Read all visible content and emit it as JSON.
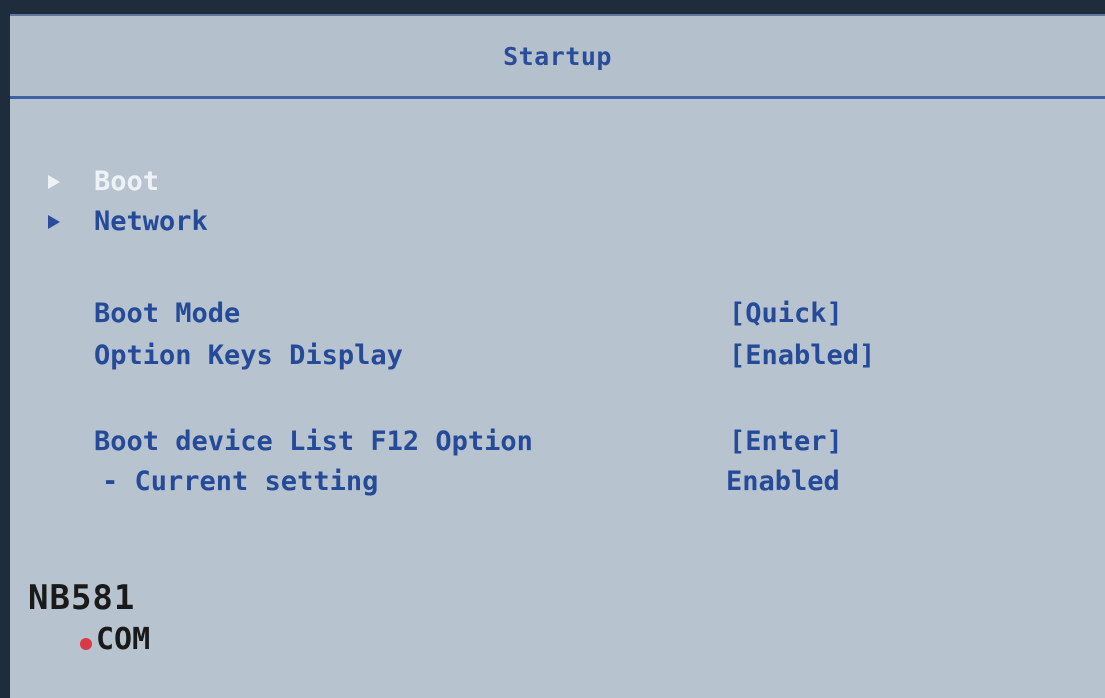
{
  "header": {
    "title": "Startup"
  },
  "submenus": [
    {
      "label": "Boot"
    },
    {
      "label": "Network"
    }
  ],
  "settings": [
    {
      "label": "Boot Mode",
      "value": "[Quick]"
    },
    {
      "label": "Option Keys Display",
      "value": "[Enabled]"
    },
    {
      "label": "Boot device List F12 Option",
      "value": "[Enter]"
    }
  ],
  "sub_setting": {
    "label": "- Current setting",
    "value": "Enabled"
  },
  "watermark": {
    "line1": "NB581",
    "line2": "COM"
  },
  "colors": {
    "background": "#b7c3cf",
    "text": "#254a98",
    "selected": "#eef2f6",
    "header_border": "#3e62a3"
  }
}
